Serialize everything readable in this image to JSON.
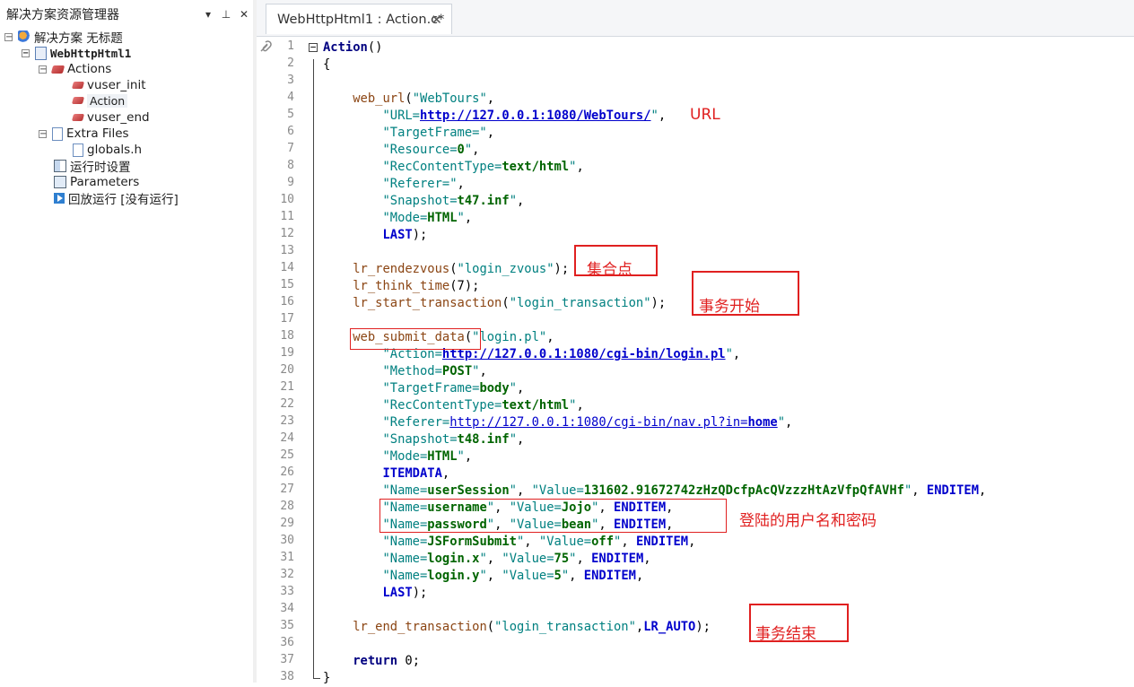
{
  "sidebar": {
    "title": "解决方案资源管理器",
    "controls": [
      "▾",
      "⊥",
      "✕"
    ],
    "tree": [
      {
        "label": "解决方案 无标题",
        "icon": "solution-icon",
        "expander": "−"
      },
      {
        "label": "WebHttpHtml1",
        "icon": "script-icon",
        "expander": "−"
      },
      {
        "label": "Actions",
        "icon": "actions-folder-icon",
        "expander": "−"
      },
      {
        "label": "vuser_init",
        "icon": "action-icon"
      },
      {
        "label": "Action",
        "icon": "action-icon"
      },
      {
        "label": "vuser_end",
        "icon": "action-icon"
      },
      {
        "label": "Extra Files",
        "icon": "file-icon",
        "expander": "−"
      },
      {
        "label": "globals.h",
        "icon": "file-icon"
      },
      {
        "label": "运行时设置",
        "icon": "runtime-settings-icon"
      },
      {
        "label": "Parameters",
        "icon": "parameters-icon"
      },
      {
        "label": "回放运行 [没有运行]",
        "icon": "replay-icon"
      }
    ]
  },
  "editor": {
    "tab": {
      "label": "WebHttpHtml1 : Action.c*",
      "close": "✕"
    },
    "line_numbers": [
      "1",
      "2",
      "3",
      "4",
      "5",
      "6",
      "7",
      "8",
      "9",
      "10",
      "11",
      "12",
      "13",
      "14",
      "15",
      "16",
      "17",
      "18",
      "19",
      "20",
      "21",
      "22",
      "23",
      "24",
      "25",
      "26",
      "27",
      "28",
      "29",
      "30",
      "31",
      "32",
      "33",
      "34",
      "35",
      "36",
      "37",
      "38"
    ],
    "code": [
      [
        {
          "t": "Action",
          "c": "kw"
        },
        {
          "t": "()",
          "c": ""
        }
      ],
      [
        {
          "t": "{",
          "c": ""
        }
      ],
      [],
      [
        {
          "t": "    ",
          "c": ""
        },
        {
          "t": "web_url",
          "c": "fn"
        },
        {
          "t": "(",
          "c": ""
        },
        {
          "t": "\"WebTours\"",
          "c": "str"
        },
        {
          "t": ",",
          "c": ""
        }
      ],
      [
        {
          "t": "        ",
          "c": ""
        },
        {
          "t": "\"URL=",
          "c": "str"
        },
        {
          "t": "http://127.0.0.1:1080/WebTours/",
          "c": "url"
        },
        {
          "t": "\"",
          "c": "str"
        },
        {
          "t": ",",
          "c": ""
        }
      ],
      [
        {
          "t": "        ",
          "c": ""
        },
        {
          "t": "\"TargetFrame=\"",
          "c": "str"
        },
        {
          "t": ",",
          "c": ""
        }
      ],
      [
        {
          "t": "        ",
          "c": ""
        },
        {
          "t": "\"Resource=",
          "c": "str"
        },
        {
          "t": "0",
          "c": "val"
        },
        {
          "t": "\"",
          "c": "str"
        },
        {
          "t": ",",
          "c": ""
        }
      ],
      [
        {
          "t": "        ",
          "c": ""
        },
        {
          "t": "\"RecContentType=",
          "c": "str"
        },
        {
          "t": "text/html",
          "c": "val"
        },
        {
          "t": "\"",
          "c": "str"
        },
        {
          "t": ",",
          "c": ""
        }
      ],
      [
        {
          "t": "        ",
          "c": ""
        },
        {
          "t": "\"Referer=\"",
          "c": "str"
        },
        {
          "t": ",",
          "c": ""
        }
      ],
      [
        {
          "t": "        ",
          "c": ""
        },
        {
          "t": "\"Snapshot=",
          "c": "str"
        },
        {
          "t": "t47.inf",
          "c": "val"
        },
        {
          "t": "\"",
          "c": "str"
        },
        {
          "t": ",",
          "c": ""
        }
      ],
      [
        {
          "t": "        ",
          "c": ""
        },
        {
          "t": "\"Mode=",
          "c": "str"
        },
        {
          "t": "HTML",
          "c": "val"
        },
        {
          "t": "\"",
          "c": "str"
        },
        {
          "t": ",",
          "c": ""
        }
      ],
      [
        {
          "t": "        ",
          "c": ""
        },
        {
          "t": "LAST",
          "c": "cst"
        },
        {
          "t": ");",
          "c": ""
        }
      ],
      [],
      [
        {
          "t": "    ",
          "c": ""
        },
        {
          "t": "lr_rendezvous",
          "c": "fn"
        },
        {
          "t": "(",
          "c": ""
        },
        {
          "t": "\"login_zvous\"",
          "c": "str"
        },
        {
          "t": ");",
          "c": ""
        }
      ],
      [
        {
          "t": "    ",
          "c": ""
        },
        {
          "t": "lr_think_time",
          "c": "fn"
        },
        {
          "t": "(7);",
          "c": ""
        }
      ],
      [
        {
          "t": "    ",
          "c": ""
        },
        {
          "t": "lr_start_transaction",
          "c": "fn"
        },
        {
          "t": "(",
          "c": ""
        },
        {
          "t": "\"login_transaction\"",
          "c": "str"
        },
        {
          "t": ");",
          "c": ""
        }
      ],
      [],
      [
        {
          "t": "    ",
          "c": ""
        },
        {
          "t": "web_submit_data",
          "c": "fn"
        },
        {
          "t": "(",
          "c": ""
        },
        {
          "t": "\"login.pl\"",
          "c": "str"
        },
        {
          "t": ",",
          "c": ""
        }
      ],
      [
        {
          "t": "        ",
          "c": ""
        },
        {
          "t": "\"Action=",
          "c": "str"
        },
        {
          "t": "http://127.0.0.1:1080/cgi-bin/login.pl",
          "c": "url"
        },
        {
          "t": "\"",
          "c": "str"
        },
        {
          "t": ",",
          "c": ""
        }
      ],
      [
        {
          "t": "        ",
          "c": ""
        },
        {
          "t": "\"Method=",
          "c": "str"
        },
        {
          "t": "POST",
          "c": "val"
        },
        {
          "t": "\"",
          "c": "str"
        },
        {
          "t": ",",
          "c": ""
        }
      ],
      [
        {
          "t": "        ",
          "c": ""
        },
        {
          "t": "\"TargetFrame=",
          "c": "str"
        },
        {
          "t": "body",
          "c": "val"
        },
        {
          "t": "\"",
          "c": "str"
        },
        {
          "t": ",",
          "c": ""
        }
      ],
      [
        {
          "t": "        ",
          "c": ""
        },
        {
          "t": "\"RecContentType=",
          "c": "str"
        },
        {
          "t": "text/html",
          "c": "val"
        },
        {
          "t": "\"",
          "c": "str"
        },
        {
          "t": ",",
          "c": ""
        }
      ],
      [
        {
          "t": "        ",
          "c": ""
        },
        {
          "t": "\"Referer=",
          "c": "str"
        },
        {
          "t": "http://127.0.0.1:1080/cgi-bin/nav.pl?in=",
          "c": "urln"
        },
        {
          "t": "home",
          "c": "url"
        },
        {
          "t": "\"",
          "c": "str"
        },
        {
          "t": ",",
          "c": ""
        }
      ],
      [
        {
          "t": "        ",
          "c": ""
        },
        {
          "t": "\"Snapshot=",
          "c": "str"
        },
        {
          "t": "t48.inf",
          "c": "val"
        },
        {
          "t": "\"",
          "c": "str"
        },
        {
          "t": ",",
          "c": ""
        }
      ],
      [
        {
          "t": "        ",
          "c": ""
        },
        {
          "t": "\"Mode=",
          "c": "str"
        },
        {
          "t": "HTML",
          "c": "val"
        },
        {
          "t": "\"",
          "c": "str"
        },
        {
          "t": ",",
          "c": ""
        }
      ],
      [
        {
          "t": "        ",
          "c": ""
        },
        {
          "t": "ITEMDATA",
          "c": "cst"
        },
        {
          "t": ",",
          "c": ""
        }
      ],
      [
        {
          "t": "        ",
          "c": ""
        },
        {
          "t": "\"Name=",
          "c": "str"
        },
        {
          "t": "userSession",
          "c": "val"
        },
        {
          "t": "\"",
          "c": "str"
        },
        {
          "t": ", ",
          "c": ""
        },
        {
          "t": "\"Value=",
          "c": "str"
        },
        {
          "t": "131602.91672742zHzQDcfpAcQVzzzHtAzVfpQfAVHf",
          "c": "val"
        },
        {
          "t": "\"",
          "c": "str"
        },
        {
          "t": ", ",
          "c": ""
        },
        {
          "t": "ENDITEM",
          "c": "cst"
        },
        {
          "t": ",",
          "c": ""
        }
      ],
      [
        {
          "t": "        ",
          "c": ""
        },
        {
          "t": "\"Name=",
          "c": "str"
        },
        {
          "t": "username",
          "c": "val"
        },
        {
          "t": "\"",
          "c": "str"
        },
        {
          "t": ", ",
          "c": ""
        },
        {
          "t": "\"Value=",
          "c": "str"
        },
        {
          "t": "Jojo",
          "c": "val"
        },
        {
          "t": "\"",
          "c": "str"
        },
        {
          "t": ", ",
          "c": ""
        },
        {
          "t": "ENDITEM",
          "c": "cst"
        },
        {
          "t": ",",
          "c": ""
        }
      ],
      [
        {
          "t": "        ",
          "c": ""
        },
        {
          "t": "\"Name=",
          "c": "str"
        },
        {
          "t": "password",
          "c": "val"
        },
        {
          "t": "\"",
          "c": "str"
        },
        {
          "t": ", ",
          "c": ""
        },
        {
          "t": "\"Value=",
          "c": "str"
        },
        {
          "t": "bean",
          "c": "val"
        },
        {
          "t": "\"",
          "c": "str"
        },
        {
          "t": ", ",
          "c": ""
        },
        {
          "t": "ENDITEM",
          "c": "cst"
        },
        {
          "t": ",",
          "c": ""
        }
      ],
      [
        {
          "t": "        ",
          "c": ""
        },
        {
          "t": "\"Name=",
          "c": "str"
        },
        {
          "t": "JSFormSubmit",
          "c": "val"
        },
        {
          "t": "\"",
          "c": "str"
        },
        {
          "t": ", ",
          "c": ""
        },
        {
          "t": "\"Value=",
          "c": "str"
        },
        {
          "t": "off",
          "c": "val"
        },
        {
          "t": "\"",
          "c": "str"
        },
        {
          "t": ", ",
          "c": ""
        },
        {
          "t": "ENDITEM",
          "c": "cst"
        },
        {
          "t": ",",
          "c": ""
        }
      ],
      [
        {
          "t": "        ",
          "c": ""
        },
        {
          "t": "\"Name=",
          "c": "str"
        },
        {
          "t": "login.x",
          "c": "val"
        },
        {
          "t": "\"",
          "c": "str"
        },
        {
          "t": ", ",
          "c": ""
        },
        {
          "t": "\"Value=",
          "c": "str"
        },
        {
          "t": "75",
          "c": "val"
        },
        {
          "t": "\"",
          "c": "str"
        },
        {
          "t": ", ",
          "c": ""
        },
        {
          "t": "ENDITEM",
          "c": "cst"
        },
        {
          "t": ",",
          "c": ""
        }
      ],
      [
        {
          "t": "        ",
          "c": ""
        },
        {
          "t": "\"Name=",
          "c": "str"
        },
        {
          "t": "login.y",
          "c": "val"
        },
        {
          "t": "\"",
          "c": "str"
        },
        {
          "t": ", ",
          "c": ""
        },
        {
          "t": "\"Value=",
          "c": "str"
        },
        {
          "t": "5",
          "c": "val"
        },
        {
          "t": "\"",
          "c": "str"
        },
        {
          "t": ", ",
          "c": ""
        },
        {
          "t": "ENDITEM",
          "c": "cst"
        },
        {
          "t": ",",
          "c": ""
        }
      ],
      [
        {
          "t": "        ",
          "c": ""
        },
        {
          "t": "LAST",
          "c": "cst"
        },
        {
          "t": ");",
          "c": ""
        }
      ],
      [],
      [
        {
          "t": "    ",
          "c": ""
        },
        {
          "t": "lr_end_transaction",
          "c": "fn"
        },
        {
          "t": "(",
          "c": ""
        },
        {
          "t": "\"login_transaction\"",
          "c": "str"
        },
        {
          "t": ",",
          "c": ""
        },
        {
          "t": "LR_AUTO",
          "c": "cst"
        },
        {
          "t": ");",
          "c": ""
        }
      ],
      [],
      [
        {
          "t": "    ",
          "c": ""
        },
        {
          "t": "return ",
          "c": "kw"
        },
        {
          "t": "0;",
          "c": ""
        }
      ],
      [
        {
          "t": "}",
          "c": ""
        }
      ]
    ]
  },
  "annotations": {
    "url": "URL",
    "rendezvous": "集合点",
    "transaction_start": "事务开始",
    "credentials": "登陆的用户名和密码",
    "transaction_end": "事务结束"
  },
  "colors": {
    "annotation": "#e02020",
    "keyword": "#000080",
    "function": "#8b4513",
    "string": "#008080",
    "value": "#006400"
  }
}
